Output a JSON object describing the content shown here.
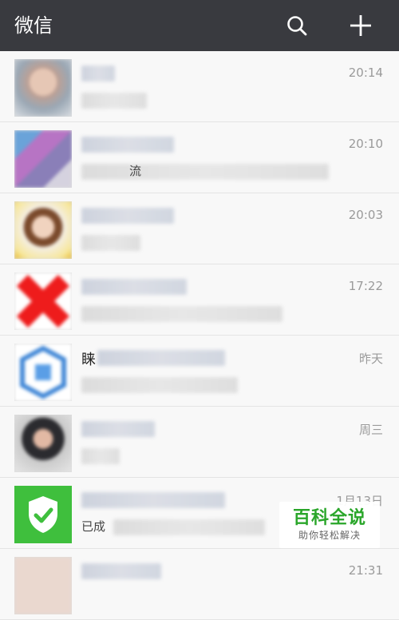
{
  "app": {
    "title": "微信",
    "header_bg": "#393a3f",
    "icons": [
      "search-icon",
      "plus-icon"
    ]
  },
  "chats": [
    {
      "name": "",
      "snippet": "",
      "time": "20:14"
    },
    {
      "name": "",
      "snippet": "流",
      "time": "20:10"
    },
    {
      "name": "",
      "snippet": "",
      "time": "20:03"
    },
    {
      "name": "",
      "snippet": "",
      "time": "17:22"
    },
    {
      "name": "睐",
      "snippet": "",
      "time": "昨天"
    },
    {
      "name": "",
      "snippet": "",
      "time": "周三"
    },
    {
      "name": "",
      "snippet": "已成",
      "time": "1月13日"
    },
    {
      "name": "",
      "snippet": "",
      "time": "21:31"
    }
  ],
  "watermark": {
    "title": "百科全说",
    "subtitle": "助你轻松解决"
  }
}
